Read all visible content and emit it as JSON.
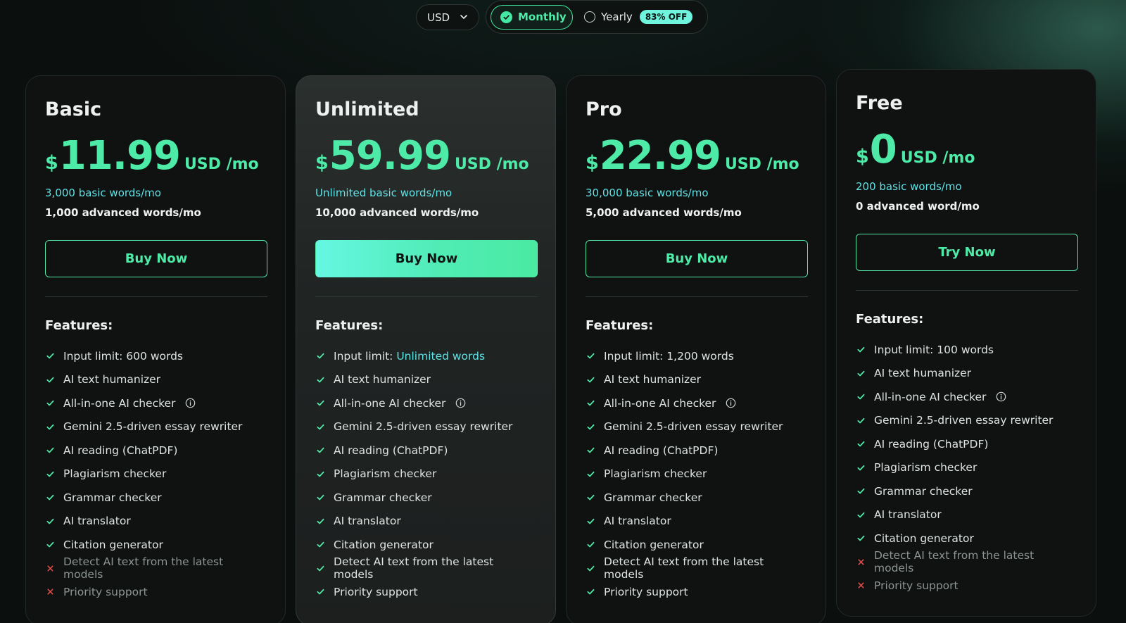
{
  "controls": {
    "currency": "USD",
    "monthly_label": "Monthly",
    "yearly_label": "Yearly",
    "yearly_badge": "83% OFF",
    "selected_period": "Monthly"
  },
  "colors": {
    "accent": "#4eeba8",
    "highlight_text": "#5fe3e6",
    "off_icon": "#e0524f"
  },
  "plans": [
    {
      "name": "Basic",
      "currency_symbol": "$",
      "price": "11.99",
      "unit": "USD /mo",
      "basic_words": "3,000 basic words/mo",
      "advanced_words": "1,000 advanced words/mo",
      "button": "Buy Now",
      "features_title": "Features:",
      "features": [
        {
          "text": "Input limit: 600 words",
          "prefix": "",
          "highlight": "",
          "included": true,
          "info": false
        },
        {
          "text": "AI text humanizer",
          "prefix": "",
          "highlight": "",
          "included": true,
          "info": false
        },
        {
          "text": "All-in-one AI checker",
          "prefix": "",
          "highlight": "",
          "included": true,
          "info": true
        },
        {
          "text": "Gemini 2.5-driven essay rewriter",
          "prefix": "",
          "highlight": "",
          "included": true,
          "info": false
        },
        {
          "text": "AI reading (ChatPDF)",
          "prefix": "",
          "highlight": "",
          "included": true,
          "info": false
        },
        {
          "text": "Plagiarism checker",
          "prefix": "",
          "highlight": "",
          "included": true,
          "info": false
        },
        {
          "text": "Grammar checker",
          "prefix": "",
          "highlight": "",
          "included": true,
          "info": false
        },
        {
          "text": "AI translator",
          "prefix": "",
          "highlight": "",
          "included": true,
          "info": false
        },
        {
          "text": "Citation generator",
          "prefix": "",
          "highlight": "",
          "included": true,
          "info": false
        },
        {
          "text": "Detect AI text from the latest models",
          "prefix": "",
          "highlight": "",
          "included": false,
          "info": false
        },
        {
          "text": "Priority support",
          "prefix": "",
          "highlight": "",
          "included": false,
          "info": false
        }
      ]
    },
    {
      "name": "Unlimited",
      "currency_symbol": "$",
      "price": "59.99",
      "unit": "USD /mo",
      "basic_words": "Unlimited basic words/mo",
      "advanced_words": "10,000 advanced words/mo",
      "button": "Buy Now",
      "features_title": "Features:",
      "features": [
        {
          "text": "",
          "prefix": "Input limit: ",
          "highlight": "Unlimited words",
          "included": true,
          "info": false
        },
        {
          "text": "AI text humanizer",
          "prefix": "",
          "highlight": "",
          "included": true,
          "info": false
        },
        {
          "text": "All-in-one AI checker",
          "prefix": "",
          "highlight": "",
          "included": true,
          "info": true
        },
        {
          "text": "Gemini 2.5-driven essay rewriter",
          "prefix": "",
          "highlight": "",
          "included": true,
          "info": false
        },
        {
          "text": "AI reading (ChatPDF)",
          "prefix": "",
          "highlight": "",
          "included": true,
          "info": false
        },
        {
          "text": "Plagiarism checker",
          "prefix": "",
          "highlight": "",
          "included": true,
          "info": false
        },
        {
          "text": "Grammar checker",
          "prefix": "",
          "highlight": "",
          "included": true,
          "info": false
        },
        {
          "text": "AI translator",
          "prefix": "",
          "highlight": "",
          "included": true,
          "info": false
        },
        {
          "text": "Citation generator",
          "prefix": "",
          "highlight": "",
          "included": true,
          "info": false
        },
        {
          "text": "Detect AI text from the latest models",
          "prefix": "",
          "highlight": "",
          "included": true,
          "info": false
        },
        {
          "text": "Priority support",
          "prefix": "",
          "highlight": "",
          "included": true,
          "info": false
        }
      ]
    },
    {
      "name": "Pro",
      "currency_symbol": "$",
      "price": "22.99",
      "unit": "USD /mo",
      "basic_words": "30,000 basic words/mo",
      "advanced_words": "5,000 advanced words/mo",
      "button": "Buy Now",
      "features_title": "Features:",
      "features": [
        {
          "text": "Input limit: 1,200 words",
          "prefix": "",
          "highlight": "",
          "included": true,
          "info": false
        },
        {
          "text": "AI text humanizer",
          "prefix": "",
          "highlight": "",
          "included": true,
          "info": false
        },
        {
          "text": "All-in-one AI checker",
          "prefix": "",
          "highlight": "",
          "included": true,
          "info": true
        },
        {
          "text": "Gemini 2.5-driven essay rewriter",
          "prefix": "",
          "highlight": "",
          "included": true,
          "info": false
        },
        {
          "text": "AI reading (ChatPDF)",
          "prefix": "",
          "highlight": "",
          "included": true,
          "info": false
        },
        {
          "text": "Plagiarism checker",
          "prefix": "",
          "highlight": "",
          "included": true,
          "info": false
        },
        {
          "text": "Grammar checker",
          "prefix": "",
          "highlight": "",
          "included": true,
          "info": false
        },
        {
          "text": "AI translator",
          "prefix": "",
          "highlight": "",
          "included": true,
          "info": false
        },
        {
          "text": "Citation generator",
          "prefix": "",
          "highlight": "",
          "included": true,
          "info": false
        },
        {
          "text": "Detect AI text from the latest models",
          "prefix": "",
          "highlight": "",
          "included": true,
          "info": false
        },
        {
          "text": "Priority support",
          "prefix": "",
          "highlight": "",
          "included": true,
          "info": false
        }
      ]
    },
    {
      "name": "Free",
      "currency_symbol": "$",
      "price": "0",
      "unit": "USD /mo",
      "basic_words": "200 basic words/mo",
      "advanced_words": "0 advanced word/mo",
      "button": "Try Now",
      "features_title": "Features:",
      "features": [
        {
          "text": "Input limit: 100 words",
          "prefix": "",
          "highlight": "",
          "included": true,
          "info": false
        },
        {
          "text": "AI text humanizer",
          "prefix": "",
          "highlight": "",
          "included": true,
          "info": false
        },
        {
          "text": "All-in-one AI checker",
          "prefix": "",
          "highlight": "",
          "included": true,
          "info": true
        },
        {
          "text": "Gemini 2.5-driven essay rewriter",
          "prefix": "",
          "highlight": "",
          "included": true,
          "info": false
        },
        {
          "text": "AI reading (ChatPDF)",
          "prefix": "",
          "highlight": "",
          "included": true,
          "info": false
        },
        {
          "text": "Plagiarism checker",
          "prefix": "",
          "highlight": "",
          "included": true,
          "info": false
        },
        {
          "text": "Grammar checker",
          "prefix": "",
          "highlight": "",
          "included": true,
          "info": false
        },
        {
          "text": "AI translator",
          "prefix": "",
          "highlight": "",
          "included": true,
          "info": false
        },
        {
          "text": "Citation generator",
          "prefix": "",
          "highlight": "",
          "included": true,
          "info": false
        },
        {
          "text": "Detect AI text from the latest models",
          "prefix": "",
          "highlight": "",
          "included": false,
          "info": false
        },
        {
          "text": "Priority support",
          "prefix": "",
          "highlight": "",
          "included": false,
          "info": false
        }
      ]
    }
  ]
}
